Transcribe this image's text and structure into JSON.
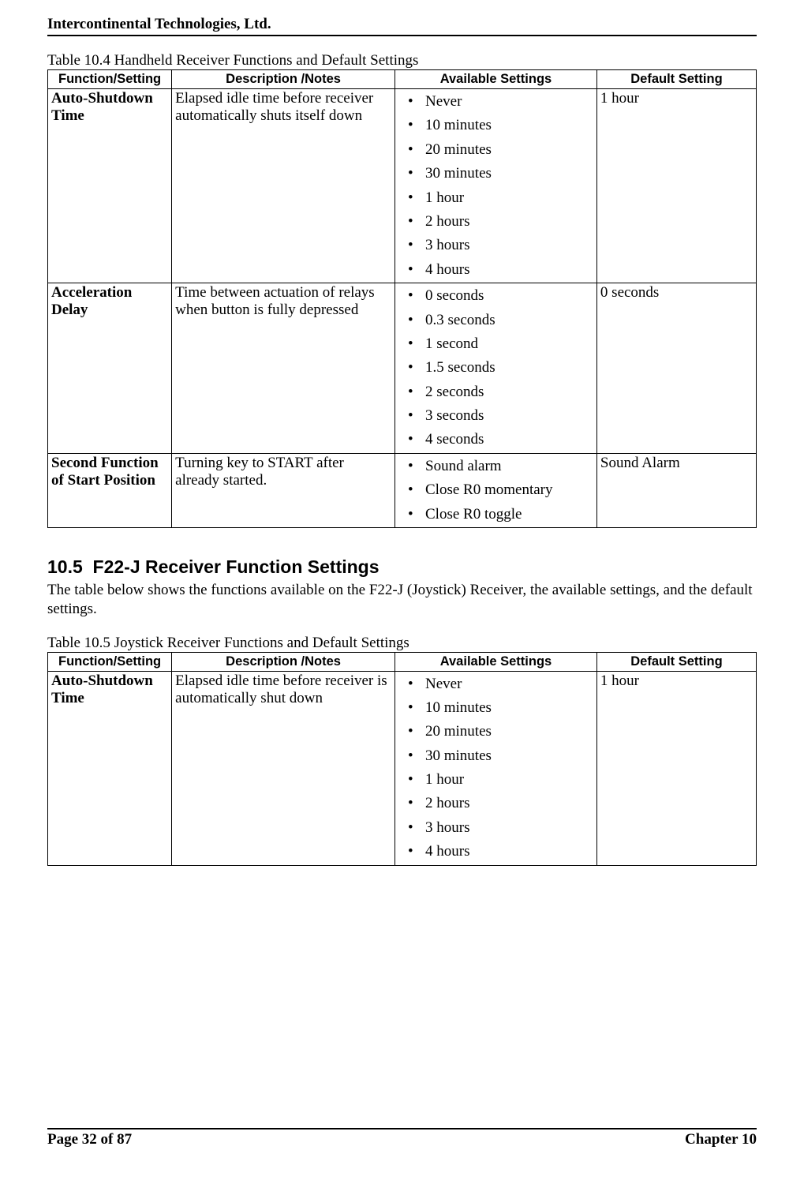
{
  "header": {
    "company": "Intercontinental Technologies, Ltd."
  },
  "table104": {
    "caption": "Table 10.4 Handheld Receiver Functions and Default Settings",
    "headers": [
      "Function/Setting",
      "Description /Notes",
      "Available Settings",
      "Default Setting"
    ],
    "rows": [
      {
        "func": "Auto-Shutdown Time",
        "desc": "Elapsed idle time before receiver automatically shuts itself down",
        "avail": [
          "Never",
          "10 minutes",
          "20 minutes",
          "30 minutes",
          "1 hour",
          "2 hours",
          "3 hours",
          "4 hours"
        ],
        "def": "1 hour"
      },
      {
        "func": "Acceleration Delay",
        "desc": "Time between actuation of relays when button is fully depressed",
        "avail": [
          "0 seconds",
          "0.3 seconds",
          "1 second",
          "1.5 seconds",
          "2 seconds",
          "3 seconds",
          "4 seconds"
        ],
        "def": "0 seconds"
      },
      {
        "func": "Second Function of Start Position",
        "desc": "Turning key to START after already started.",
        "avail": [
          "Sound alarm",
          "Close R0 momentary",
          "Close R0 toggle"
        ],
        "def": "Sound Alarm"
      }
    ]
  },
  "section105": {
    "number": "10.5",
    "title": "F22-J Receiver Function Settings",
    "intro": "The table below shows the functions available on the F22-J (Joystick) Receiver, the available settings, and the default settings."
  },
  "table105": {
    "caption": "Table 10.5 Joystick Receiver Functions and Default Settings",
    "headers": [
      "Function/Setting",
      "Description /Notes",
      "Available Settings",
      "Default Setting"
    ],
    "rows": [
      {
        "func": "Auto-Shutdown Time",
        "desc": "Elapsed idle time before receiver is automatically shut down",
        "avail": [
          "Never",
          "10 minutes",
          "20 minutes",
          "30 minutes",
          "1 hour",
          "2 hours",
          "3 hours",
          "4 hours"
        ],
        "def": "1 hour"
      }
    ]
  },
  "footer": {
    "left": "Page 32 of 87",
    "right": "Chapter 10"
  }
}
